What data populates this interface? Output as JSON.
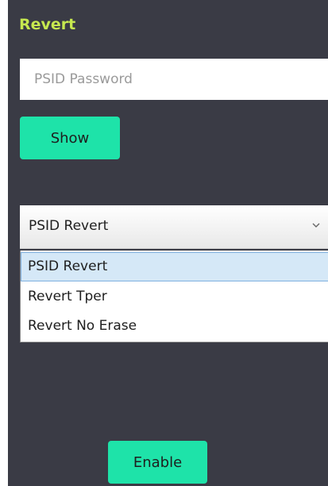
{
  "panel": {
    "title": "Revert",
    "title_color": "#c6e84f",
    "background_color": "#3a3b45"
  },
  "password_field": {
    "placeholder": "PSID Password",
    "value": ""
  },
  "show_button": {
    "label": "Show"
  },
  "revert_select": {
    "selected": "PSID Revert",
    "chevron_icon": "chevron-down-icon",
    "options": [
      {
        "label": "PSID Revert",
        "highlighted": true
      },
      {
        "label": "Revert Tper",
        "highlighted": false
      },
      {
        "label": "Revert No Erase",
        "highlighted": false
      }
    ]
  },
  "enable_button": {
    "label": "Enable"
  },
  "accent_color": "#1ee3a9"
}
